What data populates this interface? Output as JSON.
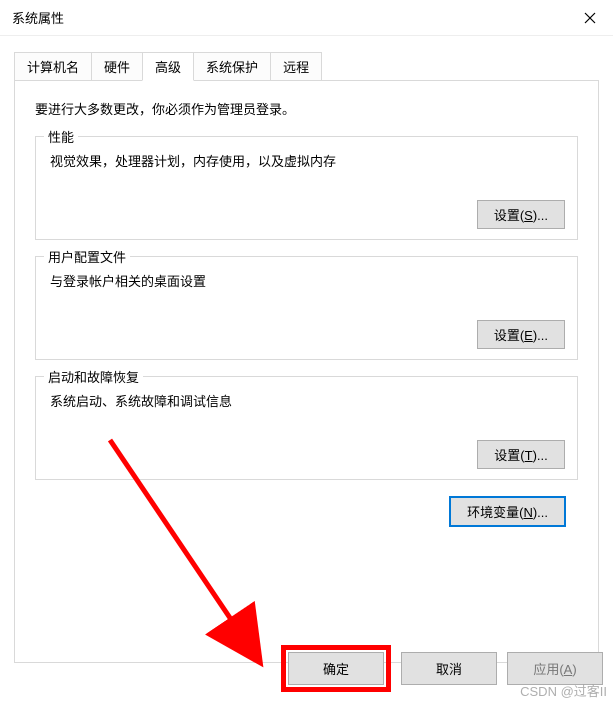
{
  "window": {
    "title": "系统属性"
  },
  "tabs": {
    "computer_name": "计算机名",
    "hardware": "硬件",
    "advanced": "高级",
    "system_protection": "系统保护",
    "remote": "远程"
  },
  "advanced": {
    "intro": "要进行大多数更改，你必须作为管理员登录。",
    "performance": {
      "title": "性能",
      "desc": "视觉效果，处理器计划，内存使用，以及虚拟内存",
      "button": "设置(S)..."
    },
    "user_profiles": {
      "title": "用户配置文件",
      "desc": "与登录帐户相关的桌面设置",
      "button": "设置(E)..."
    },
    "startup": {
      "title": "启动和故障恢复",
      "desc": "系统启动、系统故障和调试信息",
      "button": "设置(T)..."
    },
    "env_button": "环境变量(N)..."
  },
  "footer": {
    "ok": "确定",
    "cancel": "取消",
    "apply": "应用(A)"
  },
  "watermark": "CSDN @过客II"
}
